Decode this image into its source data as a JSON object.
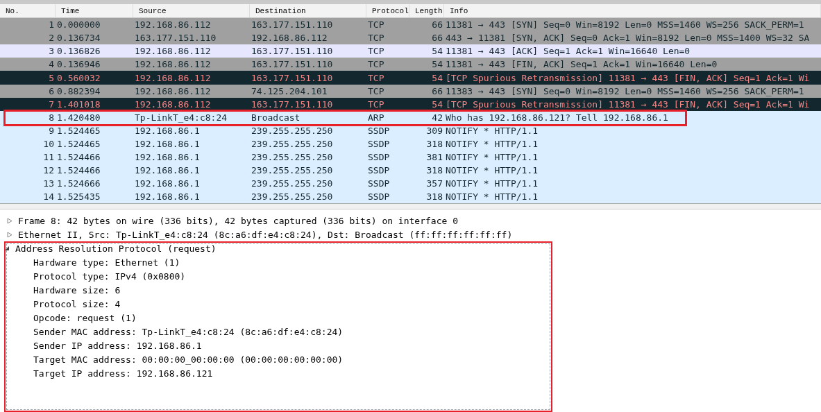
{
  "packet_list": {
    "columns": [
      "No.",
      "Time",
      "Source",
      "Destination",
      "Protocol",
      "Length",
      "Info"
    ],
    "rows": [
      {
        "kind": "tcp",
        "highlighted": false,
        "cells": [
          "1",
          "0.000000",
          "192.168.86.112",
          "163.177.151.110",
          "TCP",
          "66",
          "11381 → 443 [SYN] Seq=0 Win=8192 Len=0 MSS=1460 WS=256 SACK_PERM=1"
        ]
      },
      {
        "kind": "tcp",
        "highlighted": false,
        "cells": [
          "2",
          "0.136734",
          "163.177.151.110",
          "192.168.86.112",
          "TCP",
          "66",
          "443 → 11381 [SYN, ACK] Seq=0 Ack=1 Win=8192 Len=0 MSS=1400 WS=32 SA"
        ]
      },
      {
        "kind": "ack",
        "highlighted": false,
        "cells": [
          "3",
          "0.136826",
          "192.168.86.112",
          "163.177.151.110",
          "TCP",
          "54",
          "11381 → 443 [ACK] Seq=1 Ack=1 Win=16640 Len=0"
        ]
      },
      {
        "kind": "tcp",
        "highlighted": false,
        "cells": [
          "4",
          "0.136946",
          "192.168.86.112",
          "163.177.151.110",
          "TCP",
          "54",
          "11381 → 443 [FIN, ACK] Seq=1 Ack=1 Win=16640 Len=0"
        ]
      },
      {
        "kind": "error",
        "highlighted": false,
        "cells": [
          "5",
          "0.560032",
          "192.168.86.112",
          "163.177.151.110",
          "TCP",
          "54",
          "[TCP Spurious Retransmission] 11381 → 443 [FIN, ACK] Seq=1 Ack=1 Wi"
        ]
      },
      {
        "kind": "tcp",
        "highlighted": false,
        "cells": [
          "6",
          "0.882394",
          "192.168.86.112",
          "74.125.204.101",
          "TCP",
          "66",
          "11383 → 443 [SYN] Seq=0 Win=8192 Len=0 MSS=1460 WS=256 SACK_PERM=1"
        ]
      },
      {
        "kind": "error",
        "highlighted": false,
        "cells": [
          "7",
          "1.401018",
          "192.168.86.112",
          "163.177.151.110",
          "TCP",
          "54",
          "[TCP Spurious Retransmission] 11381 → 443 [FIN, ACK] Seq=1 Ack=1 Wi"
        ]
      },
      {
        "kind": "udp",
        "highlighted": true,
        "cells": [
          "8",
          "1.420480",
          "Tp-LinkT_e4:c8:24",
          "Broadcast",
          "ARP",
          "42",
          "Who has 192.168.86.121? Tell 192.168.86.1"
        ]
      },
      {
        "kind": "udp",
        "highlighted": false,
        "cells": [
          "9",
          "1.524465",
          "192.168.86.1",
          "239.255.255.250",
          "SSDP",
          "309",
          "NOTIFY * HTTP/1.1"
        ]
      },
      {
        "kind": "udp",
        "highlighted": false,
        "cells": [
          "10",
          "1.524465",
          "192.168.86.1",
          "239.255.255.250",
          "SSDP",
          "318",
          "NOTIFY * HTTP/1.1"
        ]
      },
      {
        "kind": "udp",
        "highlighted": false,
        "cells": [
          "11",
          "1.524466",
          "192.168.86.1",
          "239.255.255.250",
          "SSDP",
          "381",
          "NOTIFY * HTTP/1.1"
        ]
      },
      {
        "kind": "udp",
        "highlighted": false,
        "cells": [
          "12",
          "1.524466",
          "192.168.86.1",
          "239.255.255.250",
          "SSDP",
          "318",
          "NOTIFY * HTTP/1.1"
        ]
      },
      {
        "kind": "udp",
        "highlighted": false,
        "cells": [
          "13",
          "1.524666",
          "192.168.86.1",
          "239.255.255.250",
          "SSDP",
          "357",
          "NOTIFY * HTTP/1.1"
        ]
      },
      {
        "kind": "udp",
        "highlighted": false,
        "cells": [
          "14",
          "1.525435",
          "192.168.86.1",
          "239.255.255.250",
          "SSDP",
          "318",
          "NOTIFY * HTTP/1.1"
        ]
      }
    ]
  },
  "packet_details": [
    {
      "label": "Frame 8: 42 bytes on wire (336 bits), 42 bytes captured (336 bits) on interface 0",
      "expanded": false,
      "highlighted": false
    },
    {
      "label": "Ethernet II, Src: Tp-LinkT_e4:c8:24 (8c:a6:df:e4:c8:24), Dst: Broadcast (ff:ff:ff:ff:ff:ff)",
      "expanded": false,
      "highlighted": false
    },
    {
      "label": "Address Resolution Protocol (request)",
      "expanded": true,
      "highlighted": true,
      "children": [
        {
          "label": "Hardware type: Ethernet (1)"
        },
        {
          "label": "Protocol type: IPv4 (0x0800)"
        },
        {
          "label": "Hardware size: 6"
        },
        {
          "label": "Protocol size: 4"
        },
        {
          "label": "Opcode: request (1)"
        },
        {
          "label": "Sender MAC address: Tp-LinkT_e4:c8:24 (8c:a6:df:e4:c8:24)"
        },
        {
          "label": "Sender IP address: 192.168.86.1"
        },
        {
          "label": "Target MAC address: 00:00:00_00:00:00 (00:00:00:00:00:00)"
        },
        {
          "label": "Target IP address: 192.168.86.121"
        }
      ]
    }
  ]
}
